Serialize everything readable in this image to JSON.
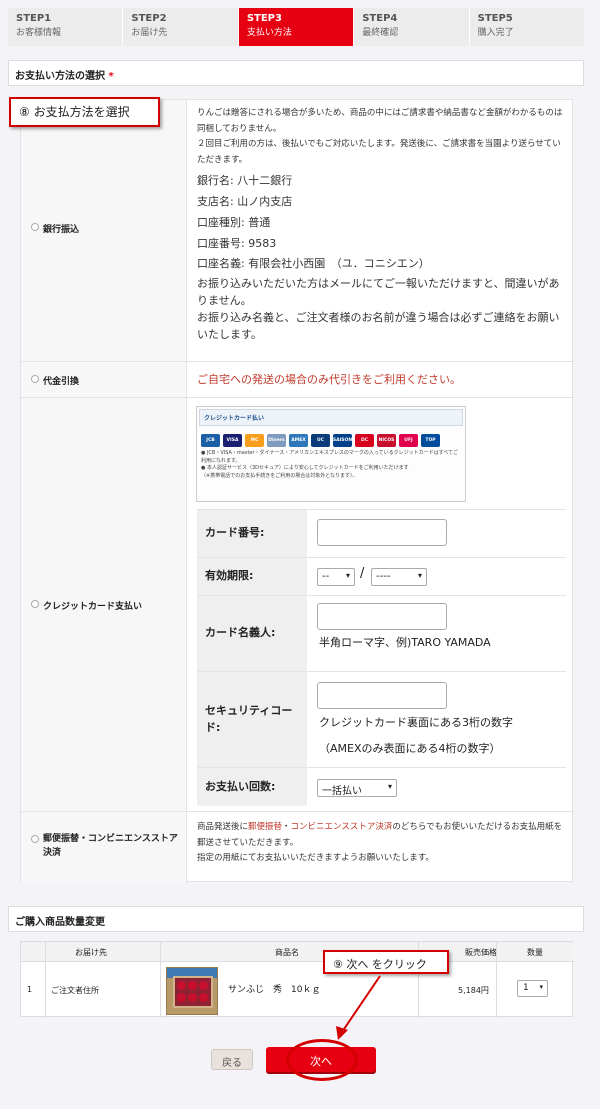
{
  "steps": [
    {
      "num": "STEP1",
      "label": "お客様情報"
    },
    {
      "num": "STEP2",
      "label": "お届け先"
    },
    {
      "num": "STEP3",
      "label": "支払い方法"
    },
    {
      "num": "STEP4",
      "label": "最終確認"
    },
    {
      "num": "STEP5",
      "label": "購入完了"
    }
  ],
  "active_step": 3,
  "payment_section": {
    "title": "お支払い方法の選択",
    "required_mark": "*"
  },
  "annotations": {
    "select_payment": "⑧ お支払方法を選択",
    "click_next": "⑨ 次へ をクリック"
  },
  "bank": {
    "label": "銀行振込",
    "intro1": "りんごは贈答にされる場合が多いため、商品の中にはご請求書や納品書など金額がわかるものは同梱しておりません。",
    "intro2": "２回目ご利用の方は、後払いでもご対応いたします。発送後に、ご請求書を当園より送らせていただきます。",
    "bank_name": "銀行名: 八十二銀行",
    "branch": "支店名: 山ノ内支店",
    "account_type": "口座種別: 普通",
    "account_no": "口座番号: 9583",
    "account_name": "口座名義: 有限会社小西園　（ユ．コニシエン）",
    "notice1": "お振り込みいただいた方はメールにてご一報いただけますと、間違いがありません。",
    "notice2": "お振り込み名義と、ご注文者様のお名前が違う場合は必ずご連絡をお願いいたします。"
  },
  "cod": {
    "label": "代金引換",
    "note": "ご自宅への発送の場合のみ代引きをご利用ください。"
  },
  "credit": {
    "label": "クレジットカード支払い",
    "box_title": "クレジットカード払い",
    "logos": [
      "JCB",
      "VISA",
      "MC",
      "Diners",
      "AMEX",
      "UC",
      "SAISON",
      "DC",
      "NICOS",
      "UFJ",
      "TOP"
    ],
    "note1": "● JCB・VISA・master・ダイナース・アメリカンエキスプレスのマークの入っているクレジットカードはすべてご利用になれます。",
    "note2": "● 本人認証サービス（3Dセキュア）により安心してクレジットカードをご利用いただけます",
    "note3": "（※携帯電話でのお支払手続きをご利用の場合は対象外となります）。",
    "card_number_label": "カード番号:",
    "expiry_label": "有効期限:",
    "expiry_month": "--",
    "expiry_sep": "/",
    "expiry_year": "----",
    "holder_label": "カード名義人:",
    "holder_hint": "半角ローマ字、例)TARO YAMADA",
    "security_label": "セキュリティコード:",
    "security_hint1": "クレジットカード裏面にある3桁の数字",
    "security_hint2": "（AMEXのみ表面にある4桁の数字）",
    "installments_label": "お支払い回数:",
    "installments_value": "一括払い"
  },
  "postal": {
    "label": "郵便振替・コンビニエンスストア決済",
    "text_a": "商品発送後に",
    "link1": "郵便振替",
    "text_b": "・",
    "link2": "コンビニエンスストア決済",
    "text_c": "のどちらでもお使いいただけるお支払用紙を郵送させていただきます。",
    "text_d": "指定の用紙にてお支払いいただきますようお願いいたします。"
  },
  "order_section": {
    "title": "ご購入商品数量変更"
  },
  "order_table": {
    "headers": {
      "destination": "お届け先",
      "product": "商品名",
      "price": "販売価格",
      "qty": "数量"
    },
    "row": {
      "index": "1",
      "destination": "ご注文者住所",
      "product": "サンふじ　秀　10ｋｇ",
      "price": "5,184円",
      "qty": "1"
    }
  },
  "buttons": {
    "back": "戻る",
    "next": "次へ"
  },
  "colors": {
    "accent": "#e60012",
    "annotation": "#d40000"
  }
}
